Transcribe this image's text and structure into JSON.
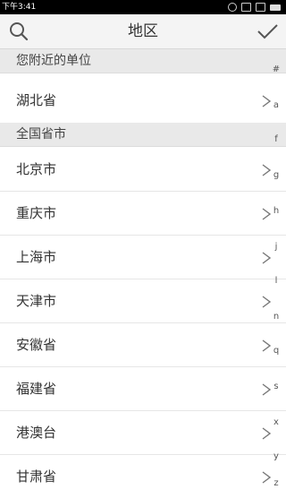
{
  "status_bar": {
    "time": "下午3:41"
  },
  "header": {
    "title": "地区"
  },
  "sections": {
    "nearby": {
      "title": "您附近的单位",
      "items": [
        "湖北省"
      ]
    },
    "all": {
      "title": "全国省市",
      "items": [
        "北京市",
        "重庆市",
        "上海市",
        "天津市",
        "安徽省",
        "福建省",
        "港澳台",
        "甘肃省"
      ]
    }
  },
  "index": [
    "#",
    "a",
    "f",
    "g",
    "h",
    "j",
    "l",
    "n",
    "q",
    "s",
    "x",
    "y",
    "z"
  ],
  "icons": {
    "search": "search-icon",
    "confirm": "checkmark-icon",
    "chevron": "chevron-right-icon"
  }
}
